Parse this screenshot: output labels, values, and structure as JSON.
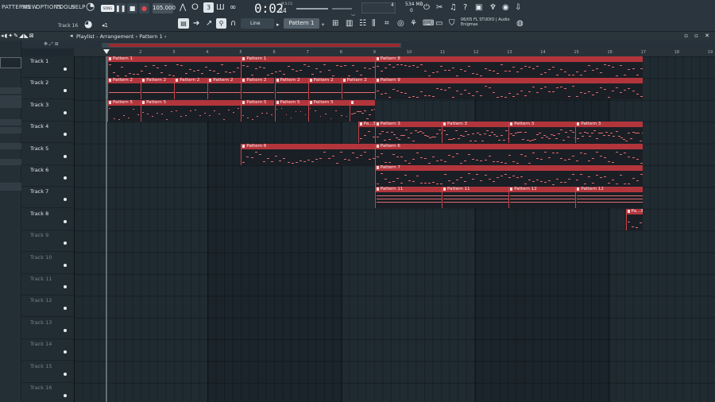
{
  "menu": {
    "items": [
      "PATTERNS",
      "VIEW",
      "OPTIONS",
      "TOOLS",
      "HELP"
    ]
  },
  "toolbar": {
    "mode_label": "SONG",
    "tempo": "105.000",
    "time_main": "0:02",
    "time_small": "24",
    "time_unit": "M:S:CS",
    "cpu_value": "4",
    "memory": "534 MB",
    "memory_sub": "0",
    "snap": "Line",
    "pattern": "Pattern 1",
    "hint_label": "Track 16",
    "news_line1": "06/05 FL STUDIO | Audio",
    "news_line2": "Enigmas"
  },
  "playlist": {
    "title": "Playlist - Arrangement › Pattern 1 ›",
    "ruler": [
      "1",
      "2",
      "3",
      "4",
      "5",
      "6",
      "7",
      "8",
      "9",
      "10",
      "11",
      "12",
      "13",
      "14",
      "15",
      "16",
      "17",
      "18",
      "19"
    ]
  },
  "tracks": [
    {
      "name": "Track 1",
      "dim": false
    },
    {
      "name": "Track 2",
      "dim": false
    },
    {
      "name": "Track 3",
      "dim": false
    },
    {
      "name": "Track 4",
      "dim": false
    },
    {
      "name": "Track 5",
      "dim": false
    },
    {
      "name": "Track 6",
      "dim": false
    },
    {
      "name": "Track 7",
      "dim": false
    },
    {
      "name": "Track 8",
      "dim": false
    },
    {
      "name": "Track 9",
      "dim": true
    },
    {
      "name": "Track 10",
      "dim": true
    },
    {
      "name": "Track 11",
      "dim": true
    },
    {
      "name": "Track 12",
      "dim": true
    },
    {
      "name": "Track 13",
      "dim": true
    },
    {
      "name": "Track 14",
      "dim": true
    },
    {
      "name": "Track 15",
      "dim": true
    },
    {
      "name": "Track 16",
      "dim": true
    }
  ],
  "clips": [
    {
      "track": 0,
      "start": 0,
      "len": 8,
      "label": "Pattern 1",
      "notes": "sparse"
    },
    {
      "track": 0,
      "start": 4,
      "len": 4,
      "label": "Pattern 1",
      "notes": "sparse"
    },
    {
      "track": 0,
      "start": 8,
      "len": 8,
      "label": "Pattern 8",
      "notes": "mid"
    },
    {
      "track": 1,
      "start": 0,
      "len": 1,
      "label": "Pattern 2",
      "notes": "line"
    },
    {
      "track": 1,
      "start": 1,
      "len": 1,
      "label": "Pattern 2",
      "notes": "line"
    },
    {
      "track": 1,
      "start": 2,
      "len": 1,
      "label": "Pattern 2",
      "notes": "line"
    },
    {
      "track": 1,
      "start": 3,
      "len": 1,
      "label": "Pattern 2",
      "notes": "line"
    },
    {
      "track": 1,
      "start": 4,
      "len": 1,
      "label": "Pattern 2",
      "notes": "line"
    },
    {
      "track": 1,
      "start": 5,
      "len": 1,
      "label": "Pattern 2",
      "notes": "line"
    },
    {
      "track": 1,
      "start": 6,
      "len": 1,
      "label": "Pattern 2",
      "notes": "line"
    },
    {
      "track": 1,
      "start": 7,
      "len": 1,
      "label": "Pattern 2",
      "notes": "line"
    },
    {
      "track": 1,
      "start": 8,
      "len": 8,
      "label": "Pattern 9",
      "notes": "mid"
    },
    {
      "track": 2,
      "start": 0,
      "len": 1,
      "label": "Pattern 5",
      "notes": "dots"
    },
    {
      "track": 2,
      "start": 1,
      "len": 3,
      "label": "Pattern 5",
      "notes": "dots"
    },
    {
      "track": 2,
      "start": 4,
      "len": 1,
      "label": "Pattern 5",
      "notes": "dots"
    },
    {
      "track": 2,
      "start": 5,
      "len": 1,
      "label": "Pattern 5",
      "notes": "dots"
    },
    {
      "track": 2,
      "start": 6,
      "len": 1.25,
      "label": "Pattern 5",
      "notes": "dots"
    },
    {
      "track": 2,
      "start": 7.25,
      "len": 0.75,
      "label": "",
      "notes": "dense"
    },
    {
      "track": 3,
      "start": 7.5,
      "len": 0.5,
      "label": "Pa...3",
      "notes": "mid"
    },
    {
      "track": 3,
      "start": 8,
      "len": 4,
      "label": "Pattern 3",
      "notes": "dense"
    },
    {
      "track": 3,
      "start": 10,
      "len": 2,
      "label": "Pattern 3",
      "notes": "dense"
    },
    {
      "track": 3,
      "start": 12,
      "len": 2,
      "label": "Pattern 3",
      "notes": "dense"
    },
    {
      "track": 3,
      "start": 14,
      "len": 2,
      "label": "Pattern 3",
      "notes": "dense"
    },
    {
      "track": 4,
      "start": 4,
      "len": 4,
      "label": "Pattern 6",
      "notes": "mid"
    },
    {
      "track": 4,
      "start": 8,
      "len": 8,
      "label": "Pattern 6",
      "notes": "mid"
    },
    {
      "track": 5,
      "start": 8,
      "len": 8,
      "label": "Pattern 7",
      "notes": "mid"
    },
    {
      "track": 6,
      "start": 8,
      "len": 2,
      "label": "Pattern 11",
      "notes": "bars"
    },
    {
      "track": 6,
      "start": 10,
      "len": 2,
      "label": "Pattern 11",
      "notes": "bars"
    },
    {
      "track": 6,
      "start": 12,
      "len": 2,
      "label": "Pattern 12",
      "notes": "bars"
    },
    {
      "track": 6,
      "start": 14,
      "len": 2,
      "label": "Pattern 12",
      "notes": "bars"
    },
    {
      "track": 7,
      "start": 15.5,
      "len": 0.5,
      "label": "Pa...3",
      "notes": "mid"
    }
  ]
}
